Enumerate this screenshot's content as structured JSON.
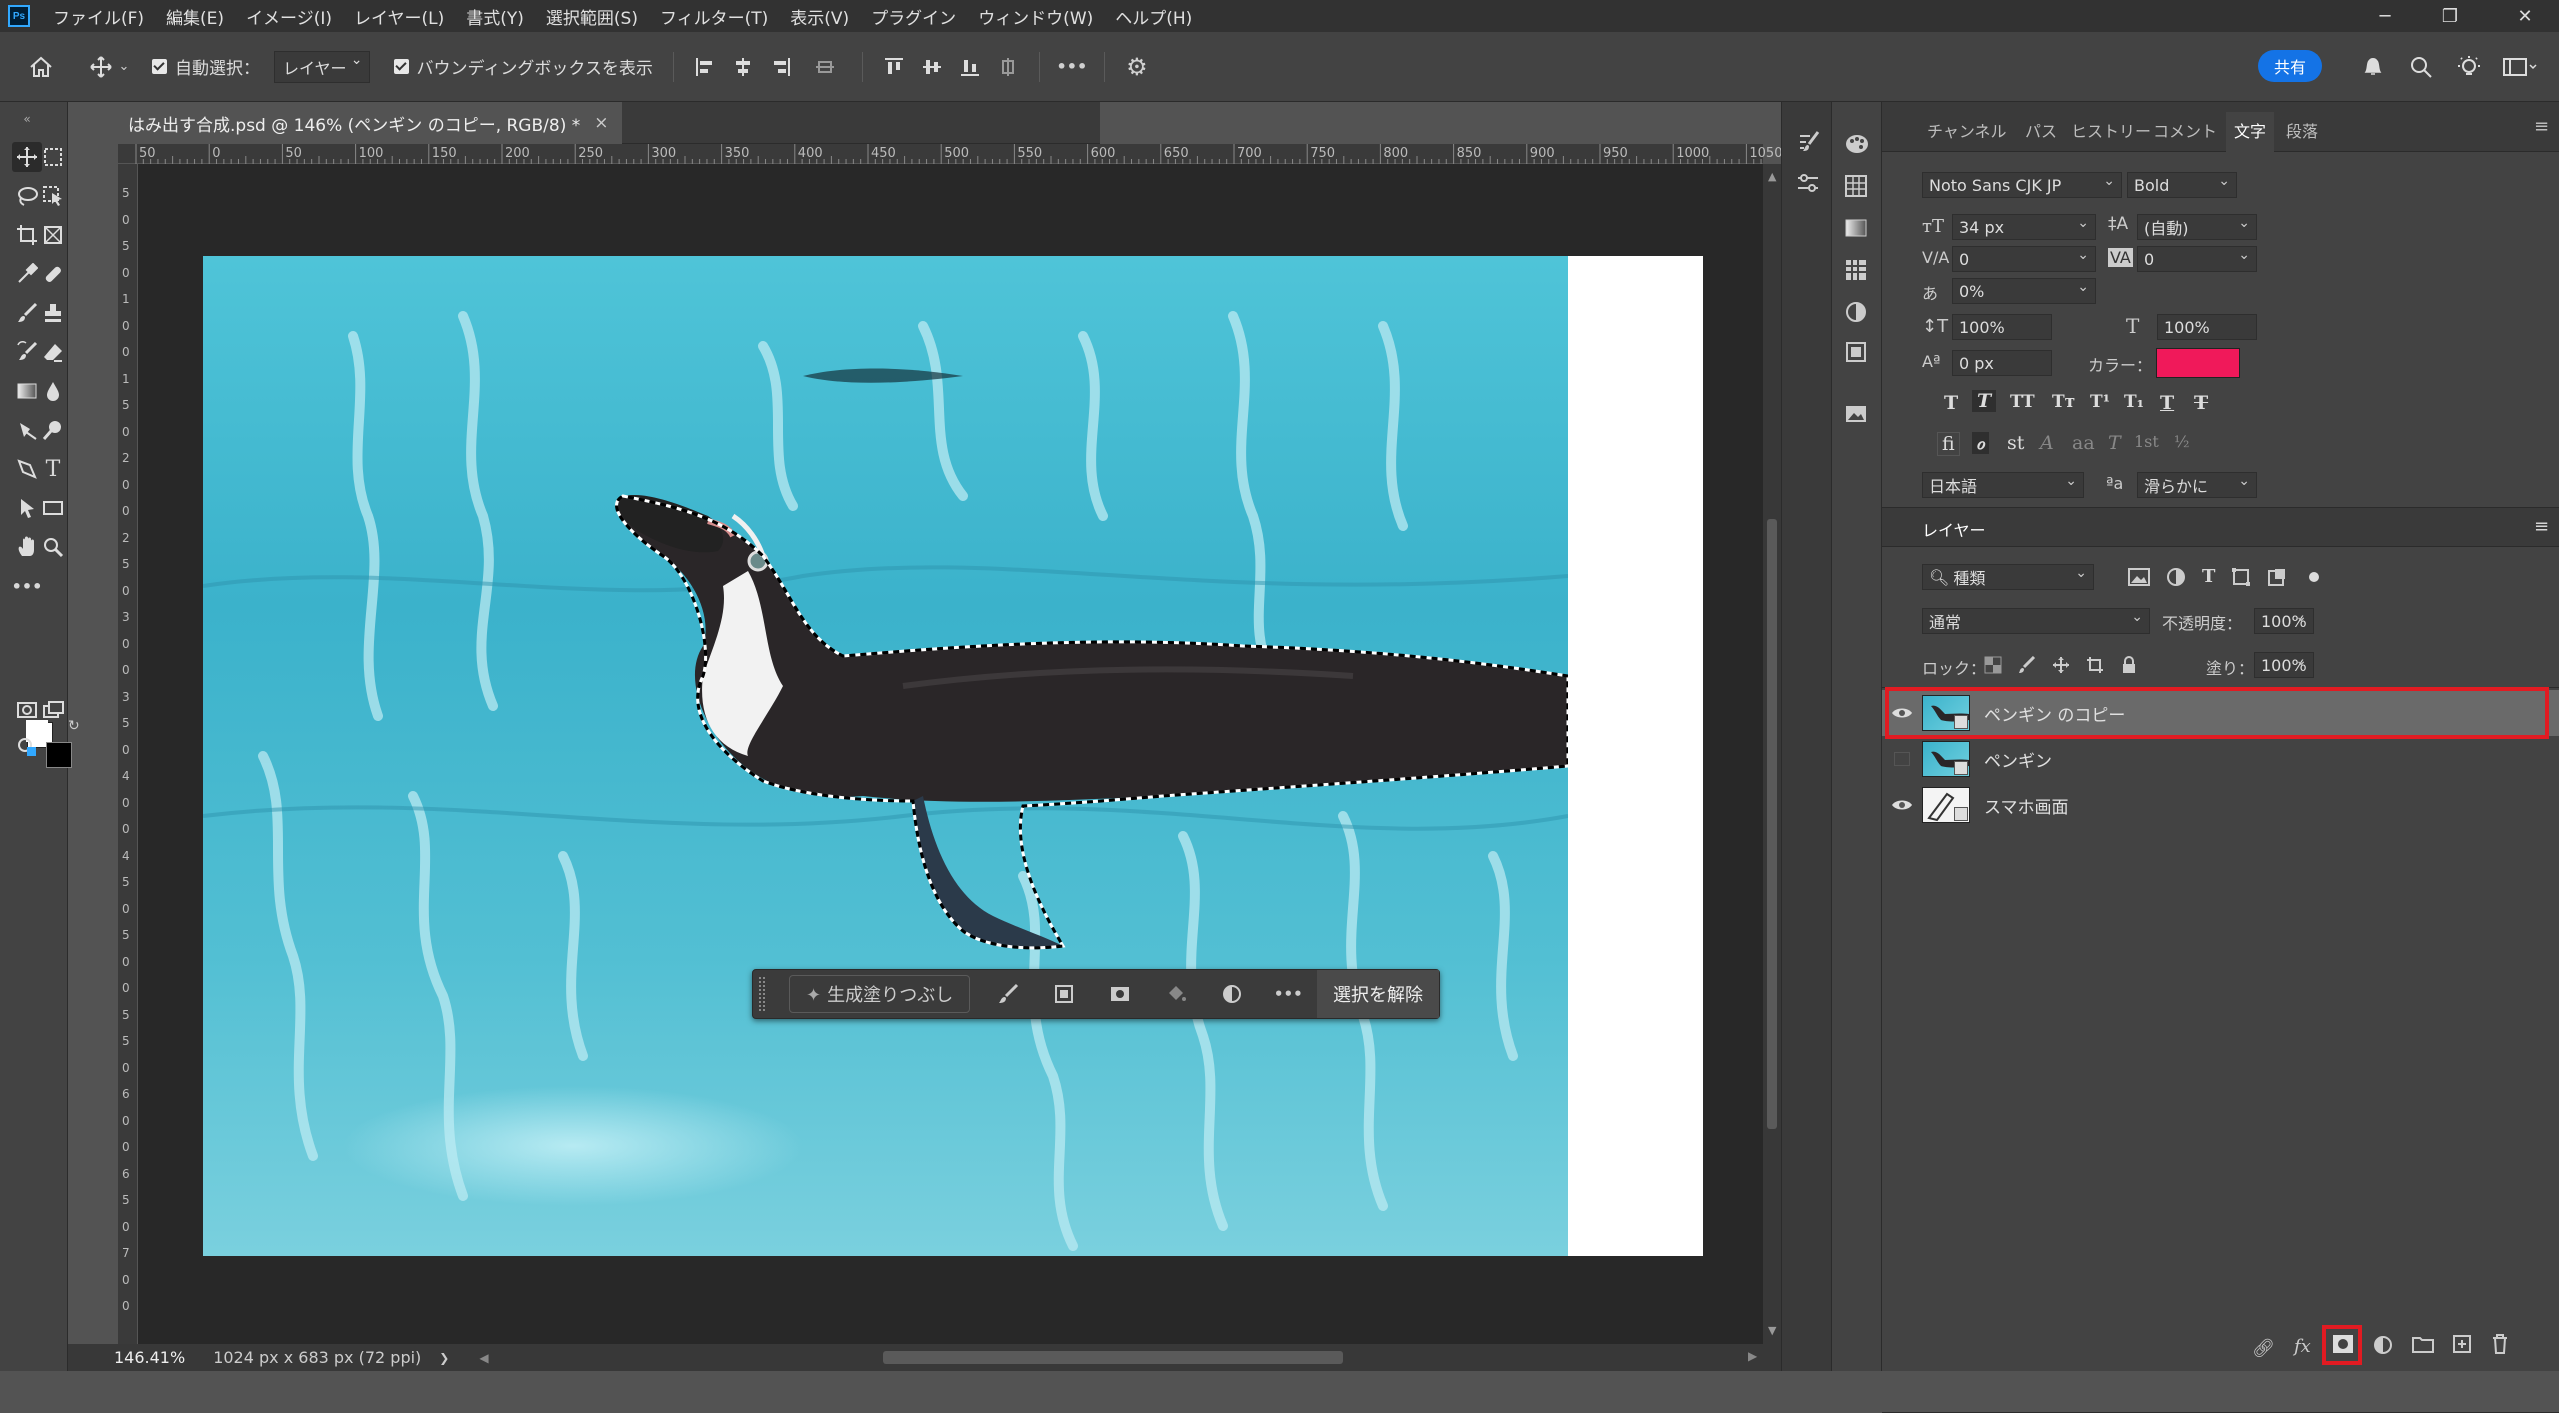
{
  "app": {
    "logo": "Ps"
  },
  "menu": [
    "ファイル(F)",
    "編集(E)",
    "イメージ(I)",
    "レイヤー(L)",
    "書式(Y)",
    "選択範囲(S)",
    "フィルター(T)",
    "表示(V)",
    "プラグイン",
    "ウィンドウ(W)",
    "ヘルプ(H)"
  ],
  "window_controls": {
    "minimize": "─",
    "restore": "❐",
    "close": "✕"
  },
  "options_bar": {
    "auto_select_label": "自動選択：",
    "auto_select_target": "レイヤー",
    "bounding_box_label": "バウンディングボックスを表示",
    "more": "•••",
    "share_label": "共有"
  },
  "document": {
    "tab_title": "はみ出す合成.psd @ 146% (ペンギン のコピー, RGB/8) *",
    "close": "×",
    "ruler_h": [
      "50",
      "0",
      "50",
      "100",
      "150",
      "200",
      "250",
      "300",
      "350",
      "400",
      "450",
      "500",
      "550",
      "600",
      "650",
      "700",
      "750",
      "800",
      "850",
      "900",
      "950",
      "1000",
      "1050"
    ],
    "ruler_v": [
      "5",
      "0",
      "5",
      "0",
      "1",
      "0",
      "0",
      "1",
      "5",
      "0",
      "2",
      "0",
      "0",
      "2",
      "5",
      "0",
      "3",
      "0",
      "0",
      "3",
      "5",
      "0",
      "4",
      "0",
      "0",
      "4",
      "5",
      "0",
      "5",
      "0",
      "0",
      "5",
      "5",
      "0",
      "6",
      "0",
      "0",
      "6",
      "5",
      "0",
      "7",
      "0",
      "0"
    ]
  },
  "context_bar": {
    "gen_fill": "生成塗りつぶし",
    "more": "•••",
    "deselect": "選択を解除"
  },
  "status": {
    "zoom": "146.41%",
    "doc_size": "1024 px x 683 px (72 ppi)",
    "arrow": "❯"
  },
  "panel_tabs": [
    "チャンネル",
    "パス",
    "ヒストリー",
    "コメント",
    "文字",
    "段落"
  ],
  "active_tab": "文字",
  "character": {
    "font_family": "Noto Sans CJK JP",
    "font_style": "Bold",
    "size": "34 px",
    "leading": "(自動)",
    "kerning": "0",
    "tracking": "0",
    "tsume": "0%",
    "v_scale": "100%",
    "h_scale": "100%",
    "baseline": "0 px",
    "color_label": "カラー：",
    "color": "#f0195a",
    "language": "日本語",
    "aa_label": "ªa",
    "antialias": "滑らかに"
  },
  "layers_panel": {
    "title": "レイヤー",
    "filter_kind": "種類",
    "blend_mode": "通常",
    "opacity_label": "不透明度：",
    "opacity": "100%",
    "lock_label": "ロック：",
    "fill_label": "塗り：",
    "fill": "100%",
    "layers": [
      {
        "name": "ペンギン のコピー",
        "visible": true,
        "selected": true
      },
      {
        "name": "ペンギン",
        "visible": false,
        "selected": false
      },
      {
        "name": "スマホ画面",
        "visible": true,
        "selected": false
      }
    ]
  },
  "highlight_color": "#e21b22"
}
